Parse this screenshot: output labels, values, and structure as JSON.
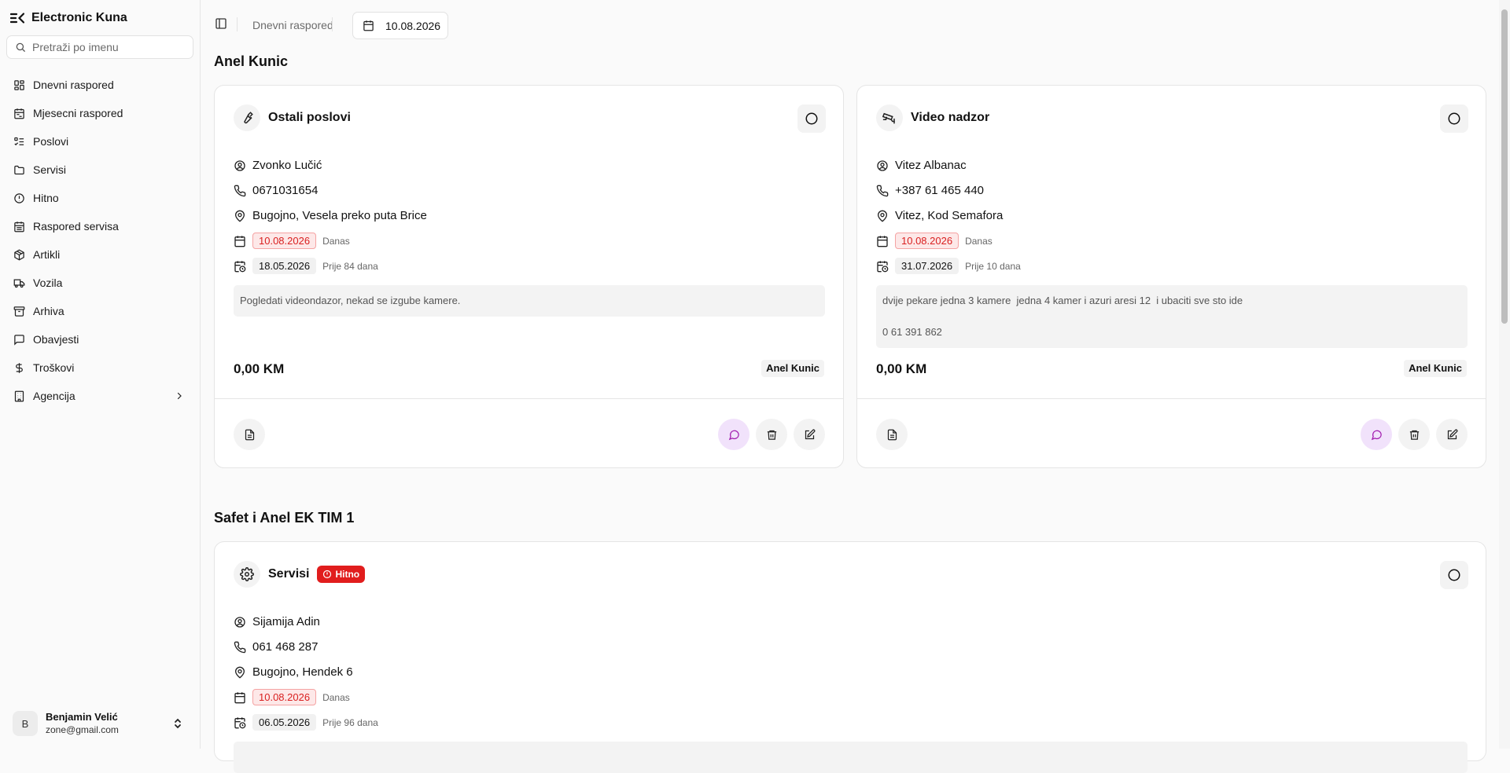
{
  "app": {
    "name": "Electronic Kuna"
  },
  "search": {
    "placeholder": "Pretraži po imenu"
  },
  "nav": {
    "items": [
      {
        "label": "Dnevni raspored",
        "icon": "layout-grid-icon"
      },
      {
        "label": "Mjesecni raspored",
        "icon": "calendar-range-icon"
      },
      {
        "label": "Poslovi",
        "icon": "list-todo-icon"
      },
      {
        "label": "Servisi",
        "icon": "folder-icon"
      },
      {
        "label": "Hitno",
        "icon": "alert-circle-icon"
      },
      {
        "label": "Raspored servisa",
        "icon": "calendar-days-icon"
      },
      {
        "label": "Artikli",
        "icon": "package-icon"
      },
      {
        "label": "Vozila",
        "icon": "truck-icon"
      },
      {
        "label": "Arhiva",
        "icon": "archive-icon"
      },
      {
        "label": "Obavjesti",
        "icon": "message-square-icon"
      },
      {
        "label": "Troškovi",
        "icon": "dollar-icon"
      },
      {
        "label": "Agencija",
        "icon": "building-icon"
      }
    ]
  },
  "user": {
    "initial": "B",
    "name": "Benjamin Velić",
    "email": "zone@gmail.com"
  },
  "header": {
    "breadcrumb": "Dnevni raspored",
    "date": "10.08.2026"
  },
  "groups": [
    {
      "title": "Anel Kunic",
      "cards": [
        {
          "title": "Ostali poslovi",
          "icon": "wrench-icon",
          "client": "Zvonko Lučić",
          "phone": "0671031654",
          "address": "Bugojno, Vesela preko puta Brice",
          "scheduled_date": "10.08.2026",
          "scheduled_rel": "Danas",
          "created_date": "18.05.2026",
          "created_rel": "Prije 84 dana",
          "note_lines": [
            "Pogledati videondazor, nekad se izgube kamere."
          ],
          "price": "0,00 KM",
          "assignee": "Anel Kunic"
        },
        {
          "title": "Video nadzor",
          "icon": "cctv-icon",
          "client": "Vitez Albanac",
          "phone": "+387 61 465 440",
          "address": "Vitez, Kod Semafora",
          "scheduled_date": "10.08.2026",
          "scheduled_rel": "Danas",
          "created_date": "31.07.2026",
          "created_rel": "Prije 10 dana",
          "note_lines": [
            "dvije pekare jedna 3 kamere  jedna 4 kamer i azuri aresi 12  i ubaciti sve sto ide",
            "0 61 391 862"
          ],
          "price": "0,00 KM",
          "assignee": "Anel Kunic"
        }
      ]
    },
    {
      "title": "Safet i Anel EK TIM 1",
      "cards": [
        {
          "title": "Servisi",
          "icon": "settings-icon",
          "badge": "Hitno",
          "client": "Sijamija Adin",
          "phone": "061 468 287",
          "address": "Bugojno, Hendek 6",
          "scheduled_date": "10.08.2026",
          "scheduled_rel": "Danas",
          "created_date": "06.05.2026",
          "created_rel": "Prije 96 dana"
        }
      ]
    }
  ],
  "colors": {
    "urgent": "#e11d1d",
    "date_red_bg": "#fde8e8",
    "chat_btn_bg": "#f1e2fb",
    "chat_icon": "#a21caf"
  }
}
